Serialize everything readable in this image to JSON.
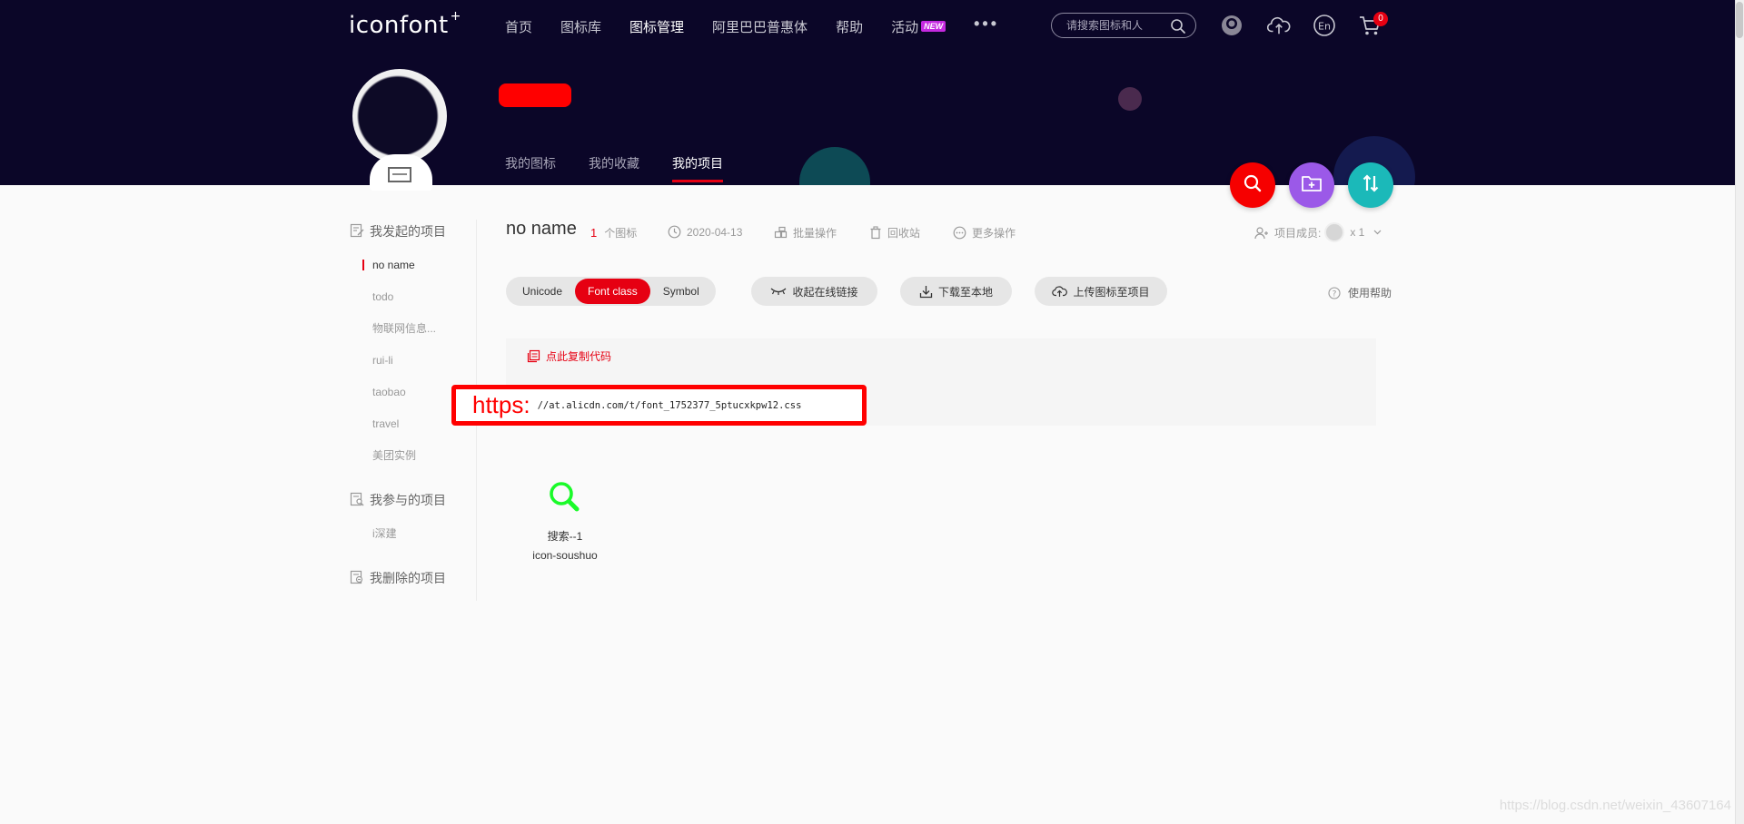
{
  "header": {
    "logo": "iconfont",
    "logo_mark": "+",
    "nav": [
      {
        "label": "首页"
      },
      {
        "label": "图标库"
      },
      {
        "label": "图标管理",
        "active": true
      },
      {
        "label": "阿里巴巴普惠体"
      },
      {
        "label": "帮助"
      },
      {
        "label": "活动",
        "badge": "NEW"
      }
    ],
    "more": "•••",
    "search_placeholder": "请搜索图标和人",
    "cart_count": "0",
    "lang_icon_text": "En"
  },
  "profile": {
    "tabs": [
      {
        "label": "我的图标"
      },
      {
        "label": "我的收藏"
      },
      {
        "label": "我的项目",
        "active": true
      }
    ]
  },
  "sidebar": {
    "groups": [
      {
        "label": "我发起的项目",
        "items": [
          "no name",
          "todo",
          "物联网信息...",
          "rui-li",
          "taobao",
          "travel",
          "美团实例"
        ],
        "active_index": 0
      },
      {
        "label": "我参与的项目",
        "items": [
          "i深建"
        ]
      },
      {
        "label": "我删除的项目",
        "items": []
      }
    ]
  },
  "project": {
    "title": "no name",
    "icon_count": "1",
    "icon_count_label": "个图标",
    "date": "2020-04-13",
    "batch": "批量操作",
    "recycle": "回收站",
    "more": "更多操作",
    "members_label": "项目成员:",
    "members_count": "x 1"
  },
  "toolbar": {
    "segments": [
      "Unicode",
      "Font class",
      "Symbol"
    ],
    "active_segment": "Font class",
    "collapse_link": "收起在线链接",
    "download": "下载至本地",
    "upload": "上传图标至项目",
    "help": "使用帮助"
  },
  "code": {
    "copy_label": "点此复制代码",
    "protocol": "https:",
    "url": "//at.alicdn.com/t/font_1752377_5ptucxkpw12.css"
  },
  "icons": [
    {
      "name": "搜索--1",
      "class": "icon-soushuo",
      "glyph": "search-icon",
      "color": "#1afa29"
    }
  ],
  "colors": {
    "header_bg": "#0b0628",
    "accent": "#e60012",
    "fab_search": "#f60000",
    "fab_folder": "#9b59e8",
    "fab_sort": "#1bb9b9"
  },
  "watermark": "https://blog.csdn.net/weixin_43607164"
}
